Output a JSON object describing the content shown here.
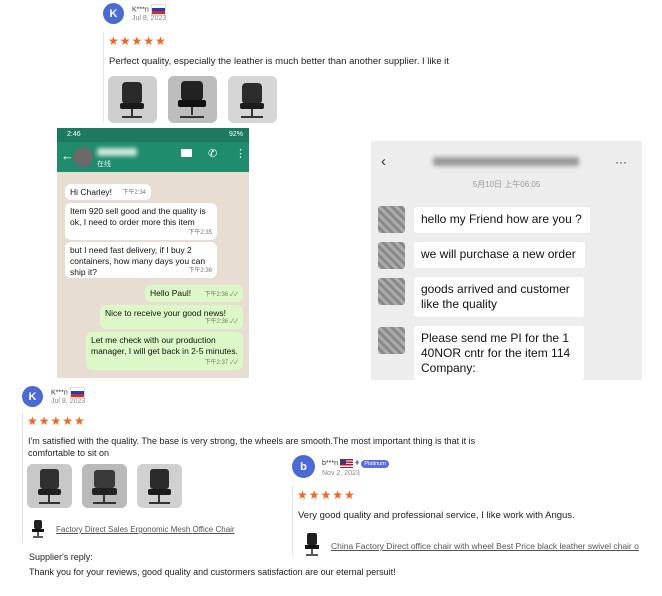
{
  "review1": {
    "avatar_letter": "K",
    "name": "K***n",
    "date": "Jul 8, 2023",
    "stars": "★★★★★",
    "text": "Perfect quality, especially the leather is much better than another supplier. I like it"
  },
  "whatsapp": {
    "status_time": "2:46",
    "status_right": "92%",
    "contact_sub": "在线",
    "messages": [
      {
        "text": "Hi Charley!",
        "time": "下午2:34"
      },
      {
        "text": "Item 920 sell good and the quality is ok, I need to order more this item",
        "time": "下午2:35"
      },
      {
        "text": "but I need fast delivery, if I buy 2 containers, how many days you can ship it?",
        "time": "下午2:36"
      },
      {
        "text": "Hello Paul!",
        "time": "下午2:36 ✓✓"
      },
      {
        "text": "Nice to receive your good news!",
        "time": "下午2:36 ✓✓"
      },
      {
        "text": "Let me check with our production manager, I will get back in 2-5 minutes.",
        "time": "下午2:37 ✓✓"
      }
    ]
  },
  "wechat": {
    "date": "5月10日 上午06:05",
    "more": "···",
    "messages": [
      {
        "text": "hello my Friend how are you ?"
      },
      {
        "text": "we will purchase a new order"
      },
      {
        "text": "goods arrived and customer like the quality"
      },
      {
        "text": "Please send me PI for the 1 40NOR cntr for the item 114 Company:"
      }
    ]
  },
  "review2": {
    "avatar_letter": "K",
    "name": "K***n",
    "date": "Jul 8, 2023",
    "stars": "★★★★★",
    "text": "I'm satisfied with the quality. The base is very strong, the wheels are smooth.The most important thing is that it is comfortable to sit on",
    "product": "Factory Direct Sales Ergonomic Mesh Office Chair",
    "reply_label": "Supplier's reply:",
    "reply_text": "Thank you for your reviews, good quality and custormers satisfaction are our eternal persuit!"
  },
  "review3": {
    "avatar_letter": "b",
    "name": "b***n",
    "badge": "Platinum",
    "date": "Nov 2, 2023",
    "stars": "★★★★★",
    "text": "Very good quality and professional service, I like work with Angus.",
    "product": "China Factory Direct office chair with wheel Best Price black leather swivel chair o"
  },
  "colors": {
    "avatar_blue": "#4a6ad6",
    "star_orange": "#f26522",
    "whatsapp_green": "#1f8c6e",
    "link_grey": "#555555"
  }
}
